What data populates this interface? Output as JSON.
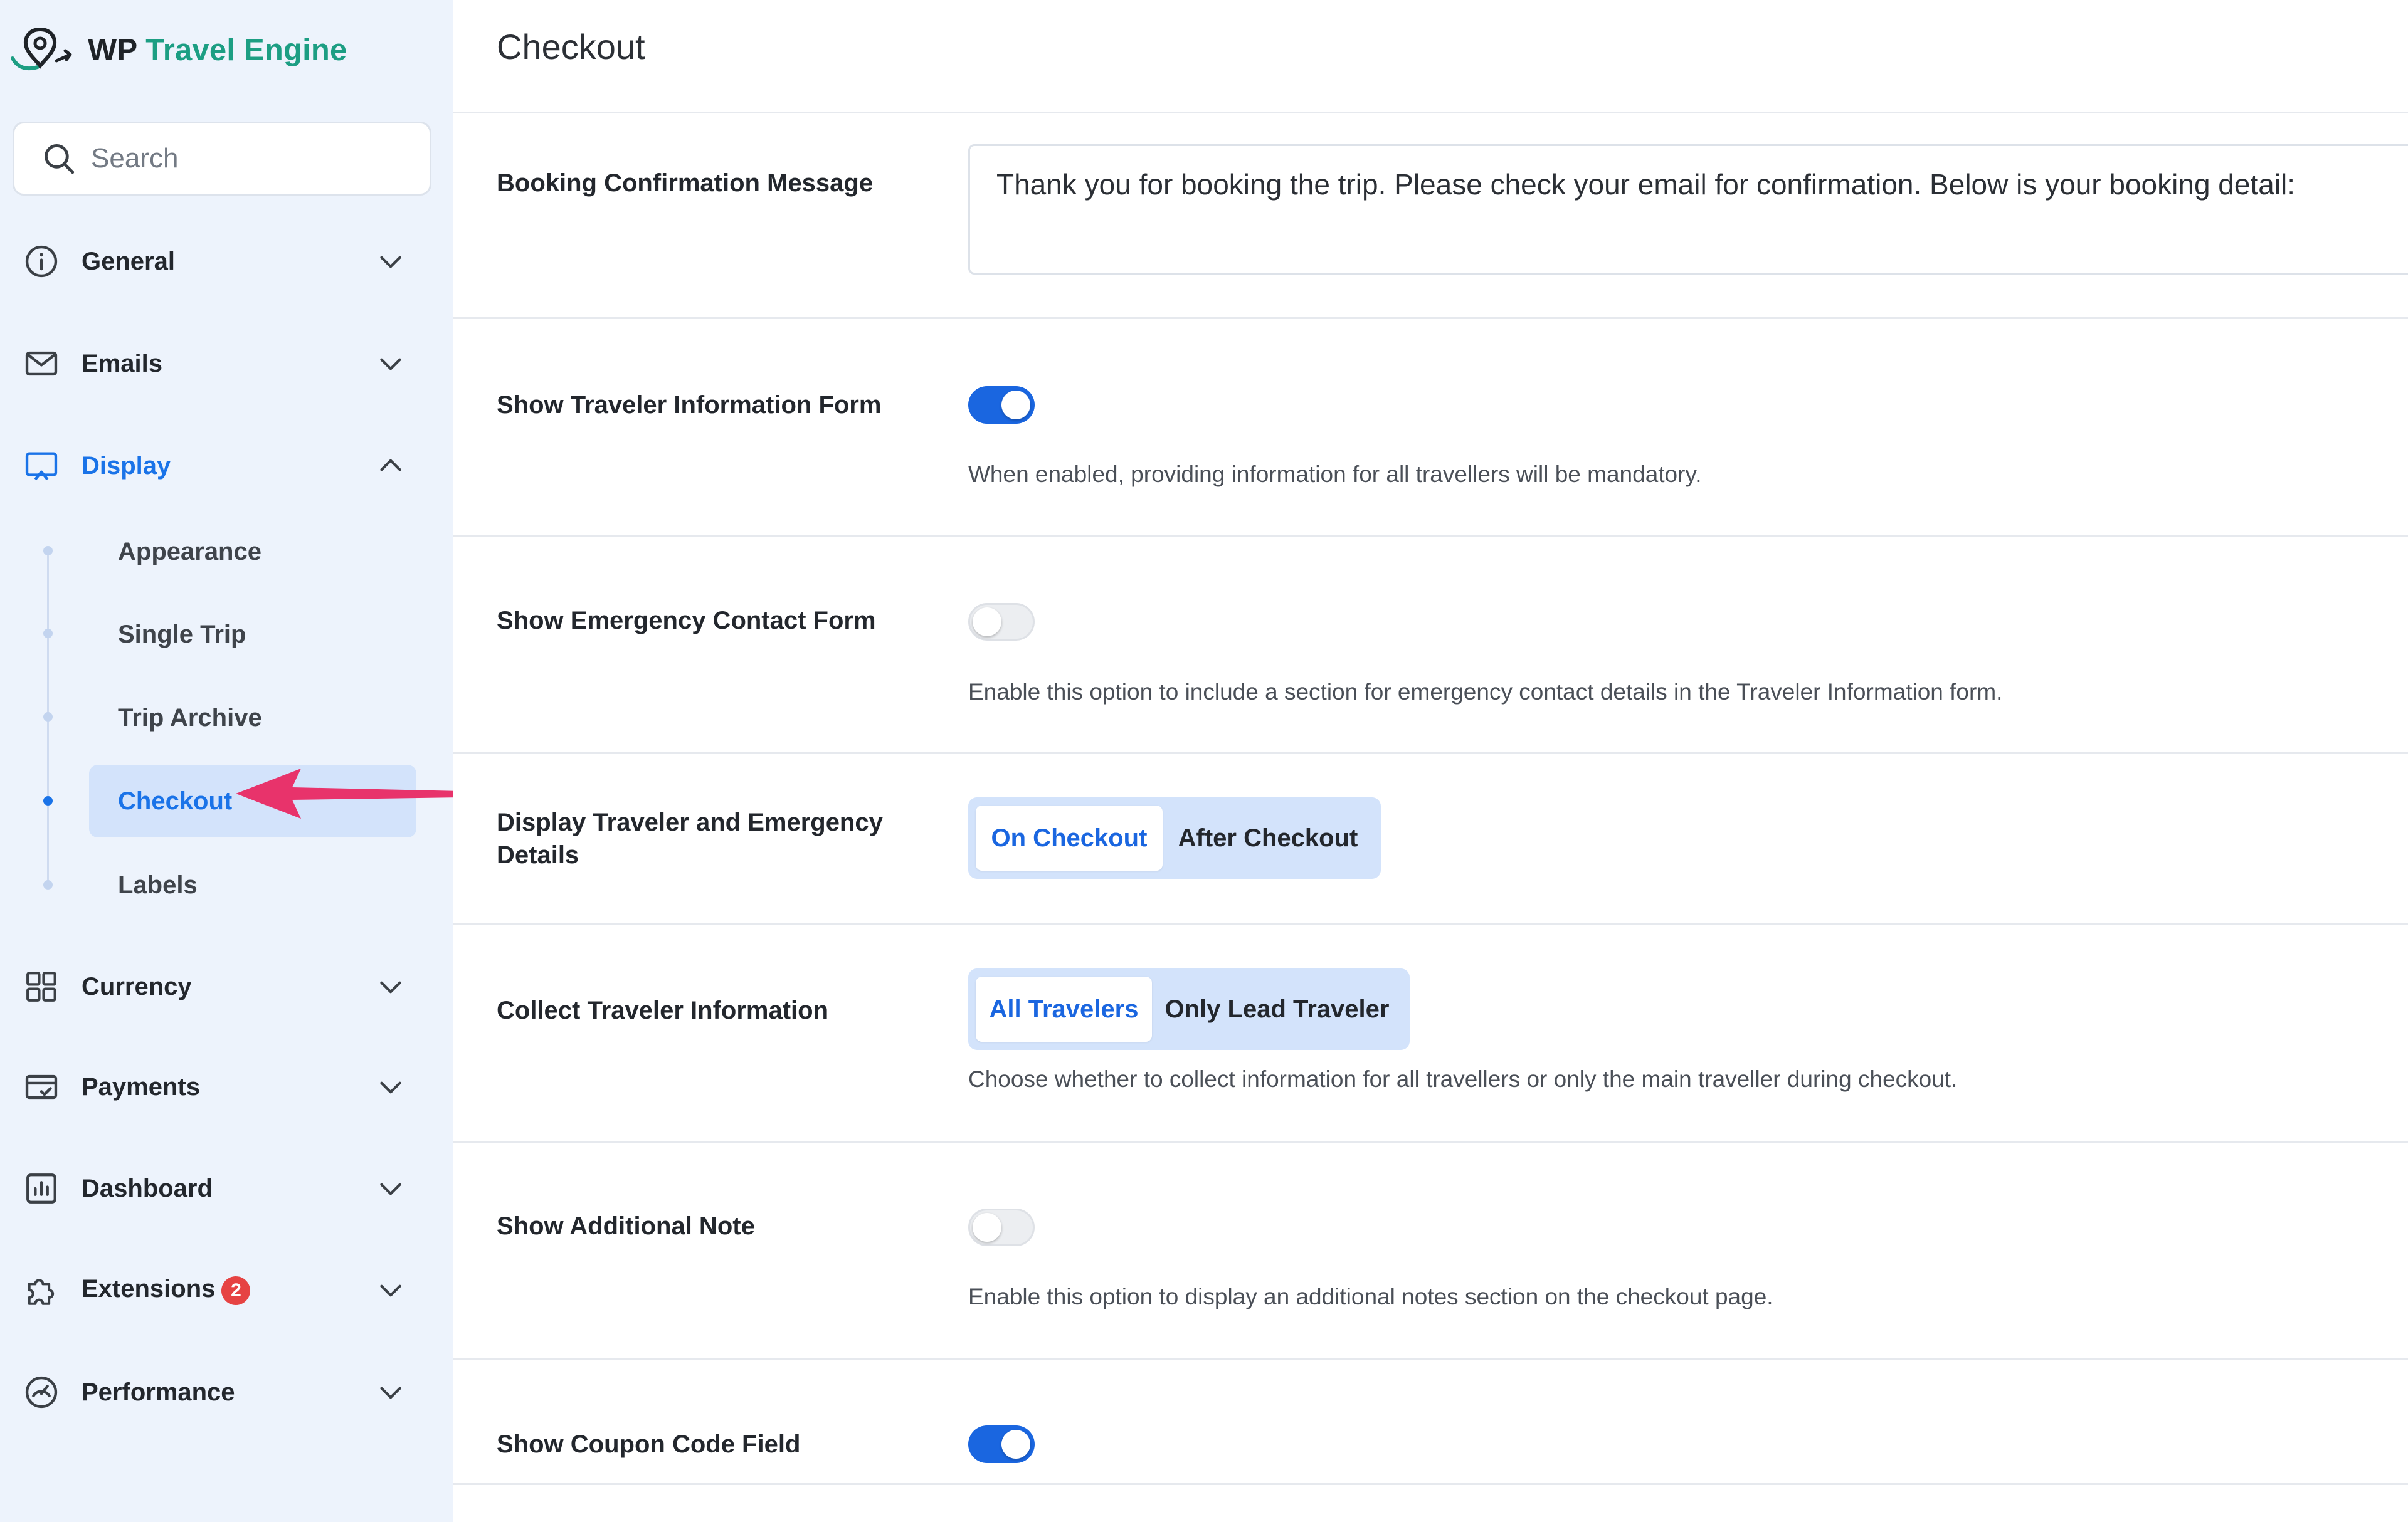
{
  "brand": {
    "prefix": "WP",
    "name": "Travel Engine"
  },
  "search": {
    "placeholder": "Search"
  },
  "nav": {
    "general": "General",
    "emails": "Emails",
    "display": "Display",
    "currency": "Currency",
    "payments": "Payments",
    "dashboard": "Dashboard",
    "extensions": "Extensions",
    "extensions_badge": "2",
    "performance": "Performance"
  },
  "subnav": {
    "items": [
      "Appearance",
      "Single Trip",
      "Trip Archive",
      "Checkout",
      "Labels"
    ],
    "active": "Checkout"
  },
  "page": {
    "title": "Checkout",
    "booking_confirmation": {
      "label": "Booking Confirmation Message",
      "value": "Thank you for booking the trip. Please check your email for confirmation. Below is your booking detail:"
    },
    "traveler_form": {
      "label": "Show Traveler Information Form",
      "enabled": true,
      "description": "When enabled, providing information for all travellers will be mandatory."
    },
    "emergency_form": {
      "label": "Show Emergency Contact Form",
      "enabled": false,
      "description": "Enable this option to include a section for emergency contact details in the Traveler Information form."
    },
    "display_details": {
      "label": "Display Traveler and Emergency Details",
      "options": [
        "On Checkout",
        "After Checkout"
      ],
      "selected": "On Checkout"
    },
    "collect_info": {
      "label": "Collect Traveler Information",
      "options": [
        "All Travelers",
        "Only Lead Traveler"
      ],
      "selected": "All Travelers",
      "description": "Choose whether to collect information for all travellers or only the main traveller during checkout."
    },
    "additional_note": {
      "label": "Show Additional Note",
      "enabled": false,
      "description": "Enable this option to display an additional notes section on the checkout page."
    },
    "coupon_field": {
      "label": "Show Coupon Code Field",
      "enabled": true
    }
  },
  "colors": {
    "accent": "#1a66e0",
    "brand_green": "#1c9e83",
    "sidebar_bg": "#edf3fc",
    "arrow": "#e8336b"
  }
}
